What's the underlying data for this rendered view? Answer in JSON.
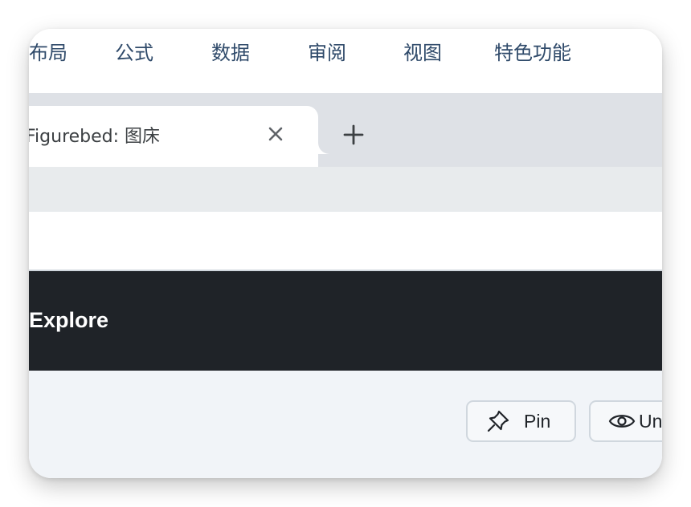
{
  "menubar": {
    "items": [
      "布局",
      "公式",
      "数据",
      "审阅",
      "视图",
      "特色功能"
    ]
  },
  "tabs": {
    "active_title": "Figurebed: 图床",
    "close_icon": "close-icon",
    "new_tab_icon": "plus-icon"
  },
  "header": {
    "explore_label": "Explore"
  },
  "repo_actions": {
    "pin_label": "Pin",
    "pin_icon": "pin-icon",
    "unwatch_label": "Unwatch",
    "unwatch_visible": "Un",
    "eye_icon": "eye-icon"
  }
}
